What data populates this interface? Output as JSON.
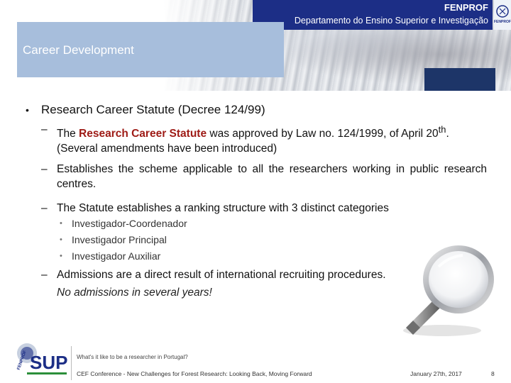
{
  "header": {
    "org_name": "FENPROF",
    "department": "Departamento do Ensino Superior e Investigação",
    "corner_logo_text": "FENPROF"
  },
  "section": {
    "title": "Career Development"
  },
  "content": {
    "point1": {
      "text": "Research Career Statute (Decree 124/99)",
      "sub1": {
        "dash": "–",
        "pre": "The ",
        "highlight": "Research Career Statute",
        "mid": " was approved by Law no. 124/1999, of April 20",
        "sup": "th",
        "post": ". (Several amendments have been introduced)"
      },
      "sub2": {
        "dash": "–",
        "text": "Establishes the scheme applicable to all the researchers working in public research centres."
      },
      "sub3": {
        "dash": "–",
        "text": "The Statute establishes a ranking structure with 3 distinct categories",
        "categories": [
          "Investigador-Coordenador",
          "Investigador Principal",
          "Investigador Auxiliar"
        ]
      },
      "sub4": {
        "dash": "–",
        "text": "Admissions are a direct result of international recruiting procedures.",
        "note": "No admissions in several years!"
      }
    }
  },
  "footer": {
    "logo_text": "SUP",
    "question": "What's it like to be a researcher in Portugal?",
    "conference": "CEF Conference - New Challenges for Forest Research: Looking Back, Moving Forward",
    "date": "January 27th, 2017",
    "page": "8"
  },
  "colors": {
    "navy": "#1c2e86",
    "banner": "#a7bedc",
    "highlight_red": "#9e1b16"
  },
  "icons": [
    "magnifying-glass-image",
    "fenprof-logo",
    "sup-logo"
  ]
}
